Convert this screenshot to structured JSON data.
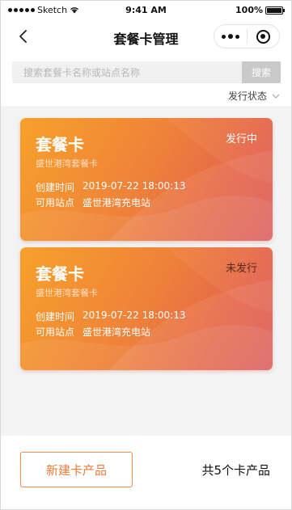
{
  "status_bar": {
    "carrier": "Sketch",
    "time": "9:41 AM",
    "battery": "100%"
  },
  "nav": {
    "title": "套餐卡管理"
  },
  "search": {
    "placeholder": "搜索套餐卡名称或站点名称",
    "value": "",
    "button_label": "搜索"
  },
  "filter": {
    "label": "发行状态"
  },
  "cards": [
    {
      "title": "套餐卡",
      "subtitle": "盛世港湾套餐卡",
      "status": "发行中",
      "created_label": "创建时间",
      "created_value": "2019-07-22 18:00:13",
      "station_label": "可用站点",
      "station_value": "盛世港湾充电站"
    },
    {
      "title": "套餐卡",
      "subtitle": "盛世港湾套餐卡",
      "status": "未发行",
      "created_label": "创建时间",
      "created_value": "2019-07-22 18:00:13",
      "station_label": "可用站点",
      "station_value": "盛世港湾充电站"
    }
  ],
  "footer": {
    "new_button_label": "新建卡产品",
    "total_text": "共5个卡产品"
  },
  "colors": {
    "card_gradient_start": "#f7a12b",
    "card_gradient_end": "#dc5a5b",
    "accent": "#ee7b3b",
    "search_button": "#c9c9c9"
  },
  "icons": [
    "signal-dots-icon",
    "wifi-icon",
    "battery-icon",
    "back-arrow-icon",
    "more-icon",
    "close-target-icon",
    "chevron-down-icon"
  ]
}
